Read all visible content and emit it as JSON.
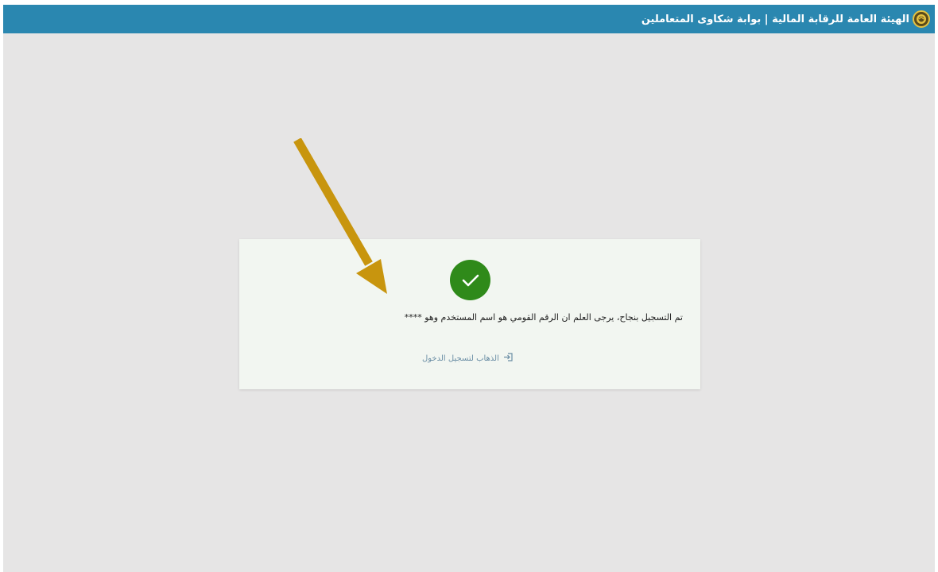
{
  "header": {
    "title": "الهيئة العامة للرقابة المالية | بوابة شكاوى المتعاملين",
    "logo_icon": "regulator-seal-logo"
  },
  "success_card": {
    "icon": "checkmark-icon",
    "message": "تم التسجيل بنجاح، يرجى العلم ان الرقم القومي هو اسم المستخدم وهو ****",
    "login_link_label": "الذهاب لتسجيل الدخول",
    "login_link_icon": "sign-in-icon"
  },
  "annotation": {
    "type": "arrow",
    "color": "#c8950e"
  },
  "colors": {
    "header_bg": "#2a87b0",
    "page_bg": "#e6e5e5",
    "card_bg": "#f2f6f1",
    "success_green": "#2f8a1a",
    "link_color": "#6b8ea5"
  }
}
